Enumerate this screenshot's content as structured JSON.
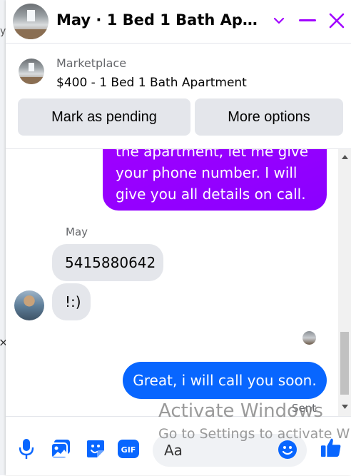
{
  "window": {
    "title": "May · 1 Bed 1 Bath Apartm..."
  },
  "listing": {
    "label": "Marketplace",
    "price_title": "$400 - 1 Bed 1 Bath Apartment",
    "mark_pending_label": "Mark as pending",
    "more_options_label": "More options"
  },
  "messages": {
    "outgoing_partial": [
      "the apartment, let me give",
      "your phone number. I will",
      "give you all details on call."
    ],
    "sender_name": "May",
    "incoming": [
      "5415880642",
      "!:)"
    ],
    "outgoing_last": "Great, i will call you soon.",
    "status": "Sent"
  },
  "composer": {
    "placeholder": "Aa",
    "icons": [
      "microphone-icon",
      "photo-icon",
      "sticker-icon",
      "gif-icon",
      "emoji-icon",
      "thumbs-up-icon"
    ],
    "gif_text": "GIF"
  },
  "overlay": {
    "activate_title": "Activate Windows",
    "activate_subtitle": "Go to Settings to activate W"
  },
  "background": {
    "left_char": "y",
    "left_close": "×"
  },
  "colors": {
    "accent": "#0866ff",
    "header_icons": "#a100ff",
    "outgoing_gradient": "#a100ff",
    "incoming_bubble": "#e4e6eb"
  }
}
